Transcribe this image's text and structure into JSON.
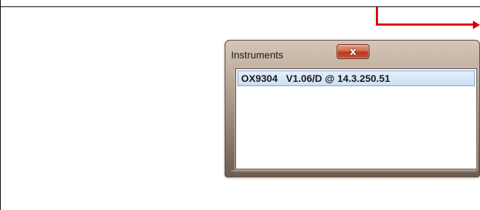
{
  "dialog": {
    "title": "Instruments",
    "close_label": "x",
    "instruments": [
      {
        "label": "OX9304   V1.06/D @ 14.3.250.51",
        "selected": true
      }
    ]
  },
  "colors": {
    "annotation_arrow": "#e00000",
    "selection_background": "#cddff6",
    "close_button": "#c7543a"
  }
}
